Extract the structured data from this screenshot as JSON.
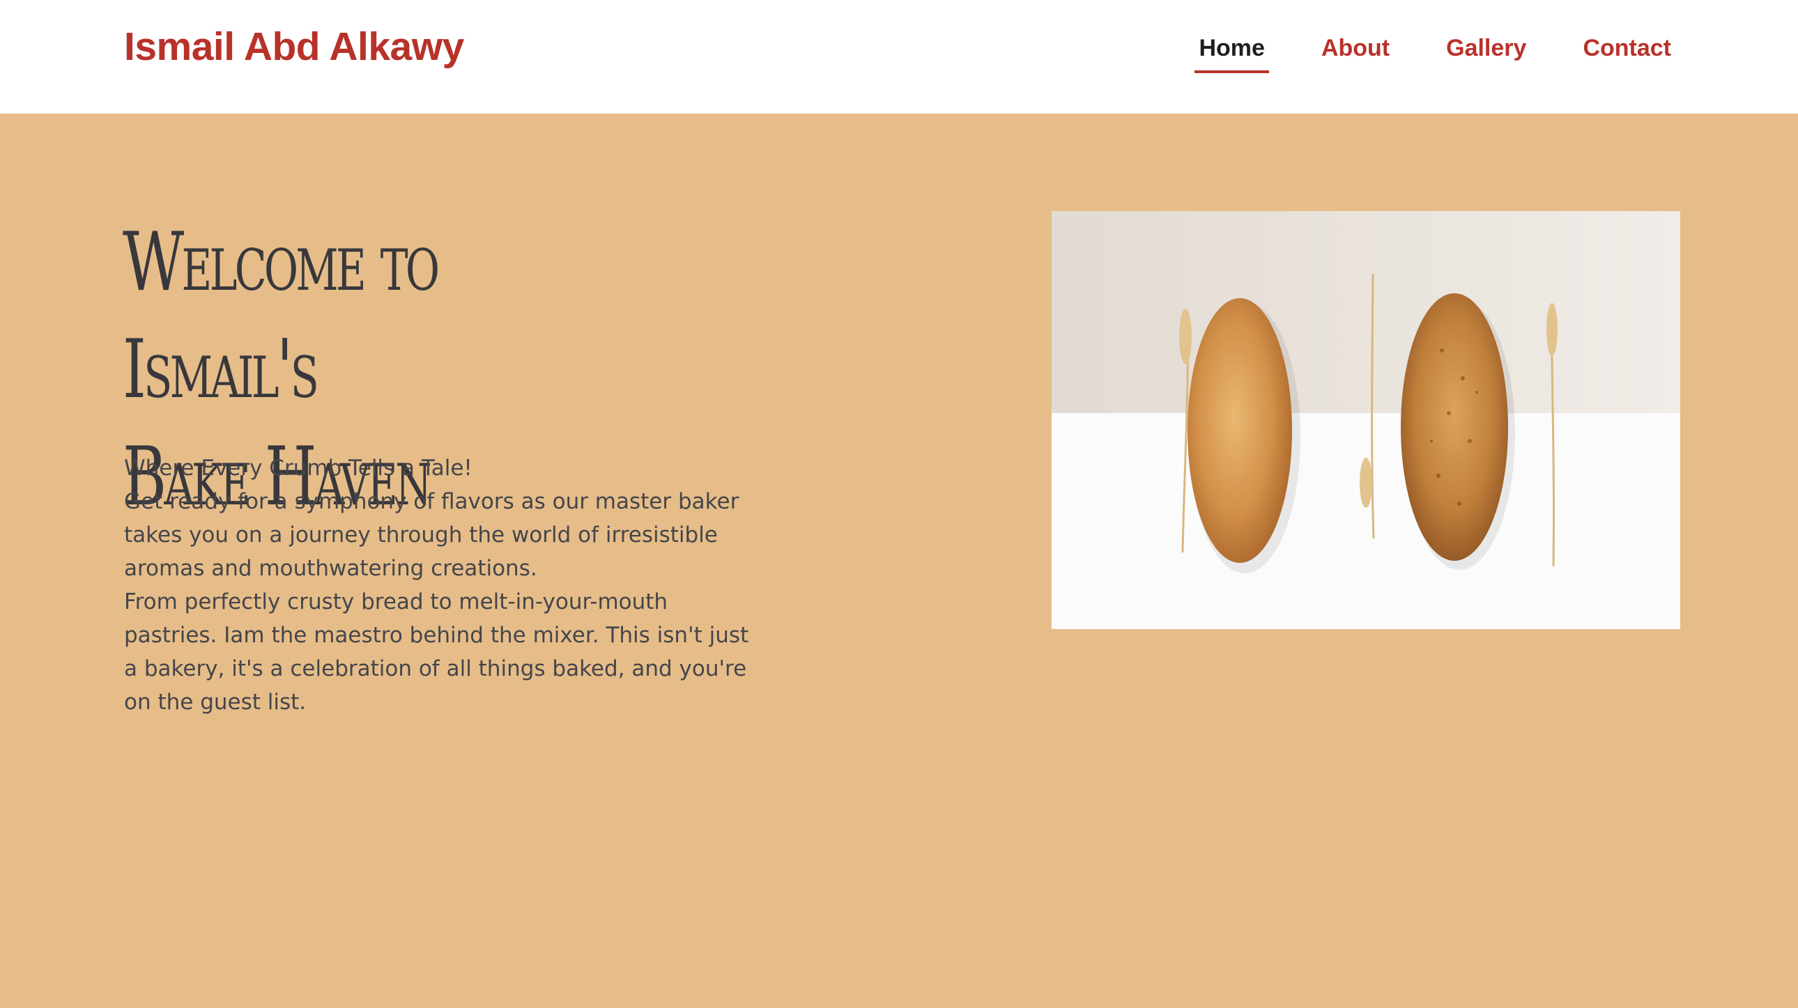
{
  "header": {
    "brand": "Ismail Abd Alkawy",
    "nav": [
      {
        "label": "Home",
        "active": true
      },
      {
        "label": "About",
        "active": false
      },
      {
        "label": "Gallery",
        "active": false
      },
      {
        "label": "Contact",
        "active": false
      }
    ]
  },
  "hero": {
    "title_line1": "Welcome to Ismail's",
    "title_line2": "Bake Haven",
    "paragraphs": [
      "Where Every Crumb Tells a Tale!",
      "Get ready for a symphony of flavors as our master baker takes you on a journey through the world of irresistible aromas and mouthwatering creations.",
      "From perfectly crusty bread to melt-in-your-mouth pastries. Iam the maestro behind the mixer. This isn't just a bakery, it's a celebration of all things baked, and you're on the guest list."
    ],
    "image": "bread-loaves-and-wheat-photo"
  },
  "colors": {
    "accent": "#b8322a",
    "background": "#e6bd89",
    "text": "#38383c"
  }
}
